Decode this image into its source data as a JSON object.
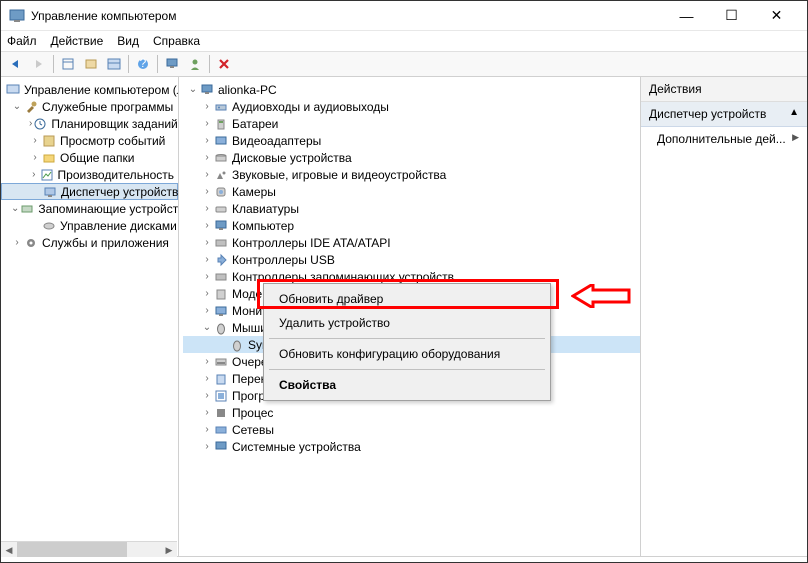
{
  "window": {
    "title": "Управление компьютером",
    "controls": {
      "min": "—",
      "max": "☐",
      "close": "✕"
    }
  },
  "menu": {
    "file": "Файл",
    "action": "Действие",
    "view": "Вид",
    "help": "Справка"
  },
  "left_tree": {
    "root": "Управление компьютером (л",
    "group1": "Служебные программы",
    "g1_items": [
      "Планировщик заданий",
      "Просмотр событий",
      "Общие папки",
      "Производительность",
      "Диспетчер устройств"
    ],
    "group2": "Запоминающие устройств",
    "g2_items": [
      "Управление дисками"
    ],
    "group3": "Службы и приложения"
  },
  "center_tree": {
    "root": "alionka-PC",
    "items": [
      "Аудиовходы и аудиовыходы",
      "Батареи",
      "Видеоадаптеры",
      "Дисковые устройства",
      "Звуковые, игровые и видеоустройства",
      "Камеры",
      "Клавиатуры",
      "Компьютер",
      "Контроллеры IDE ATA/ATAPI",
      "Контроллеры USB",
      "Контроллеры запоминающих устройств",
      "Модемы",
      "Мониторы"
    ],
    "expanded": "Мыши и иные указывающие устройства",
    "expanded_child": "Syn",
    "items_after": [
      "Очеред",
      "Перенс",
      "Програ",
      "Процес",
      "Сетевы",
      "Системные устройства"
    ]
  },
  "context_menu": {
    "update": "Обновить драйвер",
    "delete": "Удалить устройство",
    "refresh": "Обновить конфигурацию оборудования",
    "properties": "Свойства"
  },
  "actions": {
    "header": "Действия",
    "sub": "Диспетчер устройств",
    "item1": "Дополнительные дей..."
  }
}
